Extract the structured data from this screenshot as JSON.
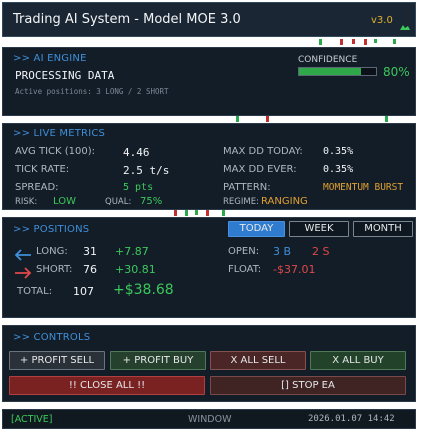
{
  "title": {
    "text": "Trading AI System - Model MOE 3.0",
    "version": "v3.0",
    "version_icon": "cloud-icon"
  },
  "ai_engine": {
    "header": ">> AI ENGINE",
    "status": "PROCESSING DATA",
    "active_positions": "Active positions: 3 LONG / 2 SHORT",
    "confidence_label": "CONFIDENCE",
    "confidence_value": "80%",
    "confidence_fraction": 0.8
  },
  "live_metrics": {
    "header": ">> LIVE METRICS",
    "left": [
      {
        "label": "AVG TICK (100):",
        "value": "4.46"
      },
      {
        "label": "TICK RATE:",
        "value": "2.5 t/s"
      },
      {
        "label": "SPREAD:",
        "value": "5 pts"
      }
    ],
    "right": [
      {
        "label": "MAX DD TODAY:",
        "value": "0.35%"
      },
      {
        "label": "MAX DD EVER:",
        "value": "0.35%"
      },
      {
        "label": "PATTERN:",
        "value": "MOMENTUM BURST"
      }
    ],
    "risk_label": "RISK:",
    "risk_value": "LOW",
    "qual_label": "QUAL:",
    "qual_value": "75%",
    "regime_label": "REGIME:",
    "regime_value": "RANGING"
  },
  "positions": {
    "header": ">> POSITIONS",
    "tabs": [
      "TODAY",
      "WEEK",
      "MONTH"
    ],
    "active_tab": "TODAY",
    "long_label": "LONG:",
    "long_count": "31",
    "long_profit": "+7.87",
    "short_label": "SHORT:",
    "short_count": "76",
    "short_profit": "+30.81",
    "total_label": "TOTAL:",
    "total_count": "107",
    "total_profit": "+$38.68",
    "open_label": "OPEN:",
    "open_buy": "3 B",
    "open_sell": "2 S",
    "float_label": "FLOAT:",
    "float_value": "-$37.01"
  },
  "controls": {
    "header": ">> CONTROLS",
    "profit_sell": "+ PROFIT SELL",
    "profit_buy": "+ PROFIT BUY",
    "x_all_sell": "X ALL SELL",
    "x_all_buy": "X ALL BUY",
    "close_all": "!! CLOSE ALL !!",
    "stop_ea": "[] STOP EA"
  },
  "status_bar": {
    "state": "[ACTIVE]",
    "mode": "WINDOW",
    "datetime": "2026.01.07 14:42"
  },
  "colors": {
    "panel_bg": "#131d28",
    "accent_blue": "#3f8fd8",
    "green": "#3cc85a",
    "red": "#e04848",
    "orange": "#e0a030",
    "cyan": "#40c8e0"
  }
}
